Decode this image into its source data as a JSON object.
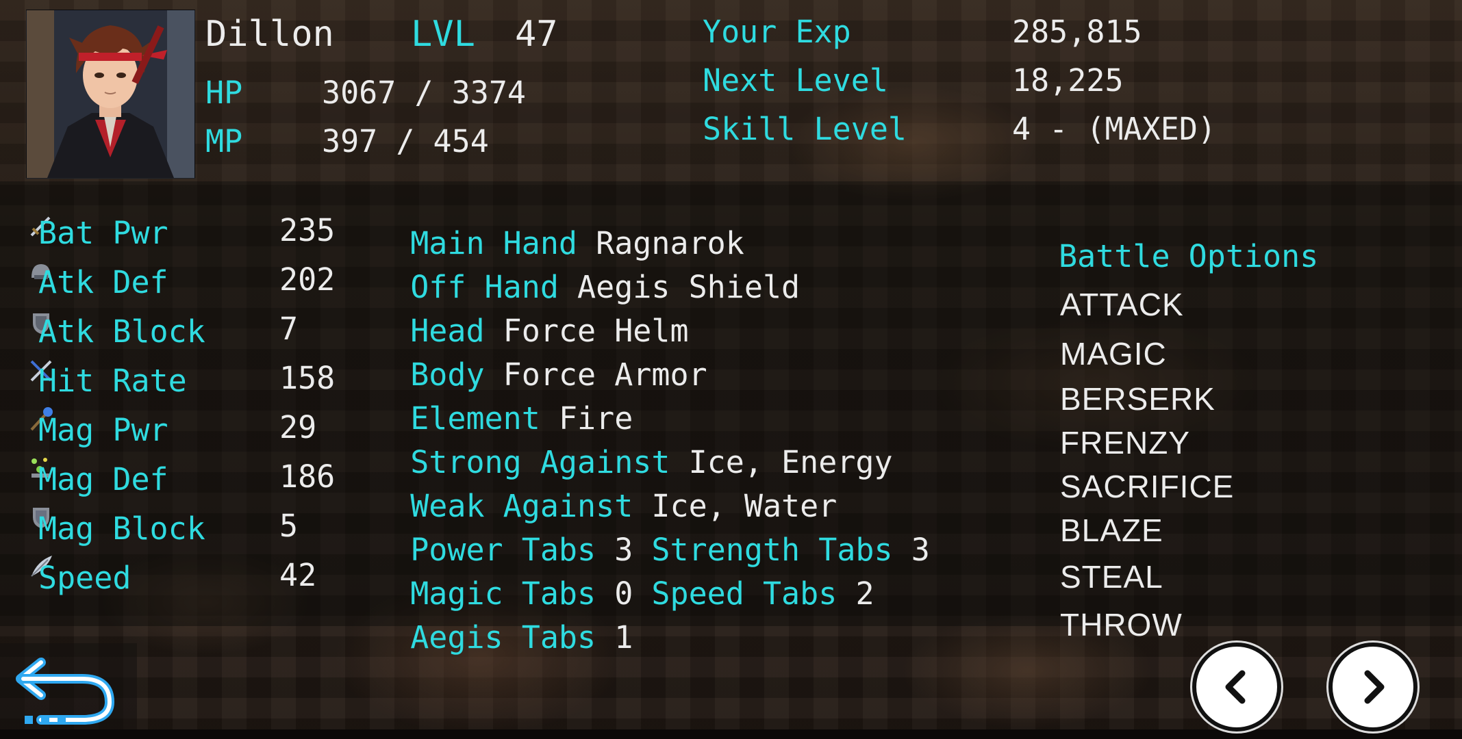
{
  "character": {
    "name": "Dillon",
    "level_label": "LVL",
    "level": "47",
    "hp_label": "HP",
    "hp": "3067 / 3374",
    "mp_label": "MP",
    "mp": "397 / 454"
  },
  "experience": {
    "your_exp_label": "Your Exp",
    "your_exp": "285,815",
    "next_level_label": "Next Level",
    "next_level": "18,225",
    "skill_level_label": "Skill Level",
    "skill_level": "4 - (MAXED)"
  },
  "stats": [
    {
      "label": "Bat Pwr",
      "value": "235",
      "icon": "sword-icon"
    },
    {
      "label": "Atk Def",
      "value": "202",
      "icon": "helmet-icon"
    },
    {
      "label": "Atk Block",
      "value": "7",
      "icon": "shield-icon"
    },
    {
      "label": "Hit Rate",
      "value": "158",
      "icon": "crossed-swords-icon"
    },
    {
      "label": "Mag Pwr",
      "value": "29",
      "icon": "magic-staff-icon"
    },
    {
      "label": "Mag Def",
      "value": "186",
      "icon": "sparkle-icon"
    },
    {
      "label": "Mag Block",
      "value": "5",
      "icon": "magic-shield-icon"
    },
    {
      "label": "Speed",
      "value": "42",
      "icon": "feather-icon"
    }
  ],
  "equipment": {
    "main_hand_label": "Main Hand",
    "main_hand": "Ragnarok",
    "off_hand_label": "Off Hand",
    "off_hand": "Aegis Shield",
    "head_label": "Head",
    "head": "Force Helm",
    "body_label": "Body",
    "body": "Force Armor",
    "element_label": "Element",
    "element": "Fire",
    "strong_label": "Strong Against",
    "strong": "Ice, Energy",
    "weak_label": "Weak Against",
    "weak": "Ice, Water",
    "power_tabs_label": "Power Tabs",
    "power_tabs": "3",
    "strength_tabs_label": "Strength Tabs",
    "strength_tabs": "3",
    "magic_tabs_label": "Magic Tabs",
    "magic_tabs": "0",
    "speed_tabs_label": "Speed Tabs",
    "speed_tabs": "2",
    "aegis_tabs_label": "Aegis Tabs",
    "aegis_tabs": "1"
  },
  "battle_options": {
    "title": "Battle Options",
    "items": [
      "ATTACK",
      "MAGIC",
      "BERSERK",
      "FRENZY",
      "SACRIFICE",
      "BLAZE",
      "STEAL",
      "THROW"
    ]
  },
  "icons": {
    "back": "back-arrow-icon",
    "prev": "chevron-left-icon",
    "next": "chevron-right-icon"
  },
  "colors": {
    "accent": "#2fdbe0",
    "text": "#ececec"
  }
}
